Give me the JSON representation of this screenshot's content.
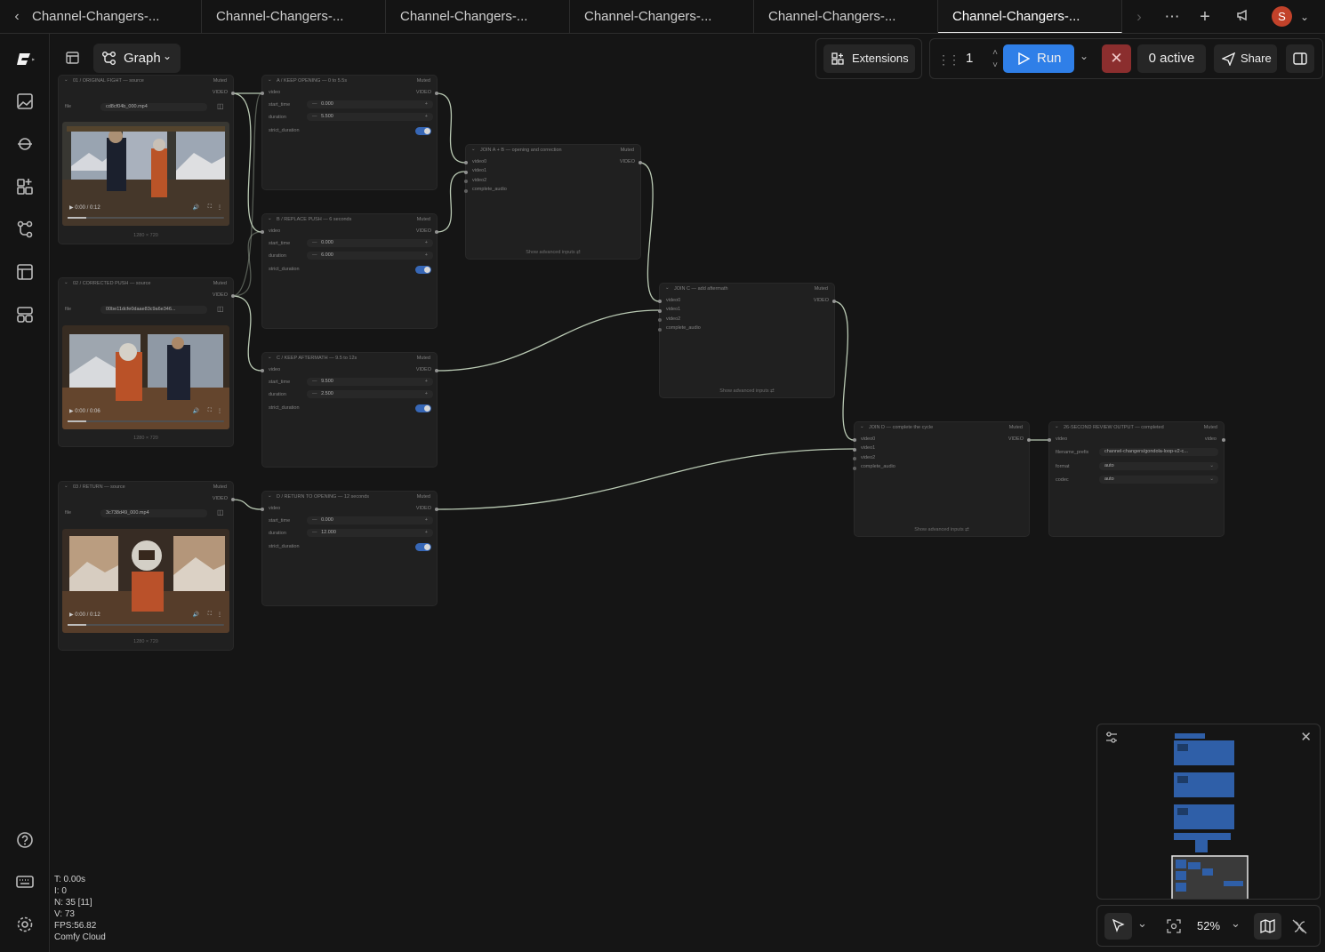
{
  "tabs": {
    "labels": [
      "Channel-Changers-...",
      "Channel-Changers-...",
      "Channel-Changers-...",
      "Channel-Changers-...",
      "Channel-Changers-...",
      "Channel-Changers-..."
    ],
    "active_index": 5,
    "avatar_initial": "S"
  },
  "toolbar": {
    "graph_label": "Graph",
    "extensions_label": "Extensions",
    "queue_count": "1",
    "run_label": "Run",
    "active_label": "0 active",
    "share_label": "Share"
  },
  "nodes": {
    "src1": {
      "title": "01 / ORIGINAL FIGHT — source",
      "muted": "Muted",
      "out": "VIDEO",
      "file_label": "file",
      "file": "cd8cf04b_000.mp4",
      "time": "0:00 / 0:12",
      "size": "1280 × 720",
      "progress": 0.0
    },
    "src2": {
      "title": "02 / CORRECTED PUSH — source",
      "muted": "Muted",
      "out": "VIDEO",
      "file_label": "file",
      "file": "00be11dcfe0daae83c9a6e346...",
      "time": "0:00 / 0:06",
      "size": "1280 × 720",
      "progress": 0.0
    },
    "src3": {
      "title": "03 / RETURN — source",
      "muted": "Muted",
      "out": "VIDEO",
      "file_label": "file",
      "file": "3c738d49_000.mp4",
      "time": "0:00 / 0:12",
      "size": "1280 × 720",
      "progress": 0.0
    },
    "trimA": {
      "title": "A / KEEP OPENING — 0 to 5.5s",
      "muted": "Muted",
      "in": "video",
      "out": "VIDEO",
      "start_label": "start_time",
      "start": "0.000",
      "dur_label": "duration",
      "dur": "5.500",
      "strict_label": "strict_duration"
    },
    "trimB": {
      "title": "B / REPLACE PUSH — 6 seconds",
      "muted": "Muted",
      "in": "video",
      "out": "VIDEO",
      "start_label": "start_time",
      "start": "0.000",
      "dur_label": "duration",
      "dur": "6.000",
      "strict_label": "strict_duration"
    },
    "trimC": {
      "title": "C / KEEP AFTERMATH — 9.5 to 12s",
      "muted": "Muted",
      "in": "video",
      "out": "VIDEO",
      "start_label": "start_time",
      "start": "9.500",
      "dur_label": "duration",
      "dur": "2.500",
      "strict_label": "strict_duration"
    },
    "trimD": {
      "title": "D / RETURN TO OPENING — 12 seconds",
      "muted": "Muted",
      "in": "video",
      "out": "VIDEO",
      "start_label": "start_time",
      "start": "0.000",
      "dur_label": "duration",
      "dur": "12.000",
      "strict_label": "strict_duration"
    },
    "joinAB": {
      "title": "JOIN A + B — opening and correction",
      "muted": "Muted",
      "out": "VIDEO",
      "inputs": [
        "video0",
        "video1",
        "video2",
        "complete_audio"
      ],
      "adv": "Show advanced inputs"
    },
    "joinC": {
      "title": "JOIN C — add aftermath",
      "muted": "Muted",
      "out": "VIDEO",
      "inputs": [
        "video0",
        "video1",
        "video2",
        "complete_audio"
      ],
      "adv": "Show advanced inputs"
    },
    "joinD": {
      "title": "JOIN D — complete the cycle",
      "muted": "Muted",
      "out": "VIDEO",
      "inputs": [
        "video0",
        "video1",
        "video2",
        "complete_audio"
      ],
      "adv": "Show advanced inputs"
    },
    "output": {
      "title": "26-SECOND REVIEW OUTPUT — completed",
      "muted": "Muted",
      "in": "video",
      "out": "video",
      "prefix_label": "filename_prefix",
      "prefix": "channel-changers/gondola-loop-v2-c...",
      "format_label": "format",
      "format": "auto",
      "codec_label": "codec",
      "codec": "auto"
    }
  },
  "stats": {
    "t": "T: 0.00s",
    "i": "I: 0",
    "n": "N: 35 [11]",
    "v": "V: 73",
    "fps": "FPS:56.82",
    "brand": "Comfy Cloud"
  },
  "zoom": {
    "level": "52%"
  },
  "colors": {
    "accent": "#2f7fe8",
    "stop": "#8b2e2e",
    "avatar": "#c2422a",
    "minimap_node": "#2f5fa8",
    "link": "#b9c9b3"
  }
}
